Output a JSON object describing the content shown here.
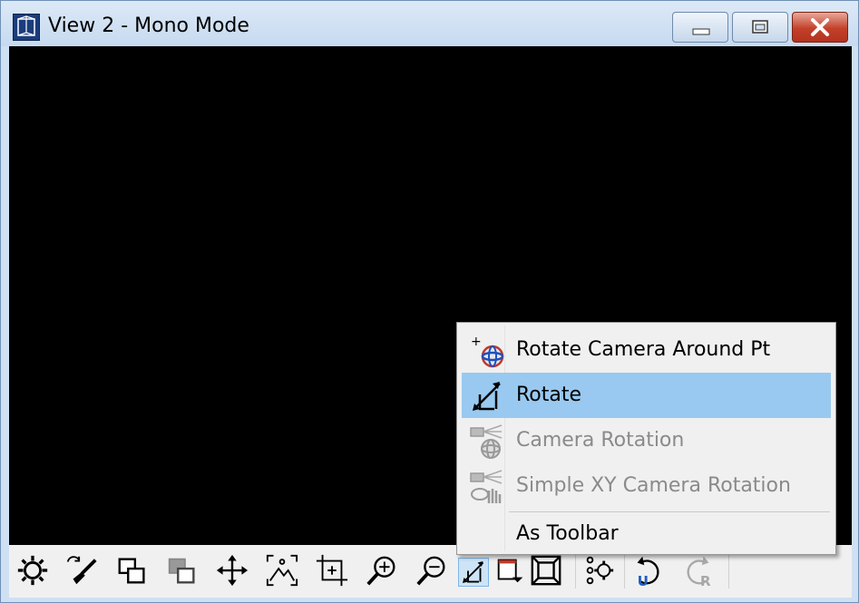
{
  "window": {
    "title": "View 2 - Mono Mode"
  },
  "caption_buttons": [
    "minimize",
    "maximize",
    "close"
  ],
  "toolbar": {
    "buttons": [
      {
        "name": "settings-icon"
      },
      {
        "name": "refresh-paint-icon"
      },
      {
        "name": "overlay-windows-icon"
      },
      {
        "name": "overlay-windows-disabled-icon"
      },
      {
        "name": "pan-icon"
      },
      {
        "name": "zoom-extents-icon"
      },
      {
        "name": "zoom-window-icon"
      },
      {
        "name": "zoom-in-icon"
      },
      {
        "name": "zoom-out-icon"
      },
      {
        "name": "rotate-icon",
        "active": true
      },
      {
        "name": "dropdown-icon"
      },
      {
        "name": "frame-icon"
      },
      {
        "name": "snap-settings-icon"
      },
      {
        "name": "undo-icon",
        "letter": "U"
      },
      {
        "name": "redo-icon",
        "letter": "R"
      }
    ]
  },
  "context_menu": {
    "items": [
      {
        "label": "Rotate Camera Around Pt",
        "icon": "rotate-camera-around-point-icon",
        "enabled": true
      },
      {
        "label": "Rotate",
        "icon": "rotate-icon",
        "enabled": true,
        "highlighted": true
      },
      {
        "label": "Camera Rotation",
        "icon": "camera-rotation-icon",
        "enabled": false
      },
      {
        "label": "Simple XY Camera Rotation",
        "icon": "simple-xy-camera-rotation-icon",
        "enabled": false
      },
      {
        "label": "As Toolbar",
        "icon": "",
        "enabled": true
      }
    ]
  }
}
